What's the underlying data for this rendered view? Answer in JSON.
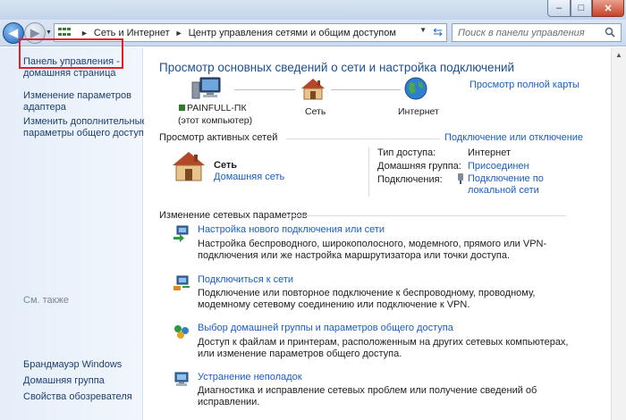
{
  "window": {
    "min_glyph": "–",
    "max_glyph": "□",
    "close_glyph": "✕"
  },
  "nav": {
    "back_glyph": "◀",
    "forward_glyph": "▶",
    "breadcrumb": [
      "Сеть и Интернет",
      "Центр управления сетями и общим доступом"
    ],
    "separator": "►",
    "search_placeholder": "Поиск в панели управления"
  },
  "sidebar": {
    "home_line1": "Панель управления -",
    "home_line2": "домашняя страница",
    "adapter_line1": "Изменение параметров",
    "adapter_line2": "адаптера",
    "sharing_line1": "Изменить дополнительные",
    "sharing_line2": "параметры общего доступа",
    "see_also": "См. также",
    "links": [
      "Брандмауэр Windows",
      "Домашняя группа",
      "Свойства обозревателя"
    ]
  },
  "main": {
    "title": "Просмотр основных сведений о сети и настройка подключений",
    "full_map": "Просмотр полной карты",
    "map": {
      "computer_name": "PAINFULL-ПК",
      "computer_sub": "(этот компьютер)",
      "network": "Сеть",
      "internet": "Интернет"
    },
    "active": {
      "header": "Просмотр активных сетей",
      "connect_link": "Подключение или отключение",
      "network_name": "Сеть",
      "network_type": "Домашняя сеть",
      "access_label": "Тип доступа:",
      "access_value": "Интернет",
      "homegroup_label": "Домашняя группа:",
      "homegroup_value": "Присоединен",
      "connections_label": "Подключения:",
      "connections_value_line1": "Подключение по",
      "connections_value_line2": "локальной сети"
    },
    "change": {
      "header": "Изменение сетевых параметров",
      "tasks": [
        {
          "title": "Настройка нового подключения или сети",
          "desc": "Настройка беспроводного, широкополосного, модемного, прямого или VPN-подключения или же настройка маршрутизатора или точки доступа."
        },
        {
          "title": "Подключиться к сети",
          "desc": "Подключение или повторное подключение к беспроводному, проводному, модемному сетевому соединению или подключение к VPN."
        },
        {
          "title": "Выбор домашней группы и параметров общего доступа",
          "desc": "Доступ к файлам и принтерам, расположенным на других сетевых компьютерах, или изменение параметров общего доступа."
        },
        {
          "title": "Устранение неполадок",
          "desc": "Диагностика и исправление сетевых проблем или получение сведений об исправлении."
        }
      ]
    }
  },
  "colors": {
    "link": "#1a5dc6",
    "title": "#1f4e8f",
    "highlight": "#e3202a"
  }
}
